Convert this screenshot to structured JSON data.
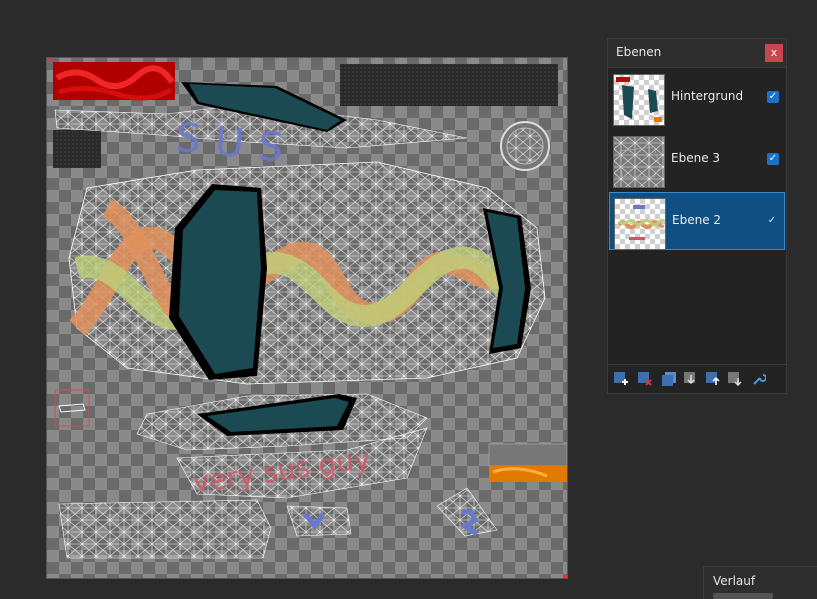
{
  "layers_panel": {
    "title": "Ebenen",
    "close_label": "x",
    "layers": [
      {
        "name": "Hintergrund",
        "visible": true,
        "selected": false
      },
      {
        "name": "Ebene 3",
        "visible": true,
        "selected": false
      },
      {
        "name": "Ebene 2",
        "visible": true,
        "selected": true
      }
    ],
    "toolbar_icons": [
      "add-layer-icon",
      "delete-layer-icon",
      "duplicate-layer-icon",
      "merge-down-icon",
      "move-layer-up-icon",
      "move-layer-down-icon",
      "layer-properties-icon"
    ]
  },
  "history_panel": {
    "title": "Verlauf"
  },
  "canvas": {
    "text_sus": "SUS",
    "text_very_sus_guy": "very sus guy",
    "colors": {
      "window_glass": "#1b4a52",
      "stripe_orange": "#e0905a",
      "stripe_green": "#bfcf7a",
      "text_blue": "#6a78cc",
      "text_red": "#d25565",
      "red_block": "#c40000",
      "orange_block": "#e07a00"
    }
  },
  "colors": {
    "selected_layer": "#0f4f82",
    "checkbox": "#1a73c8",
    "close_button": "#c8464d",
    "app_background": "#2b2b2b"
  }
}
